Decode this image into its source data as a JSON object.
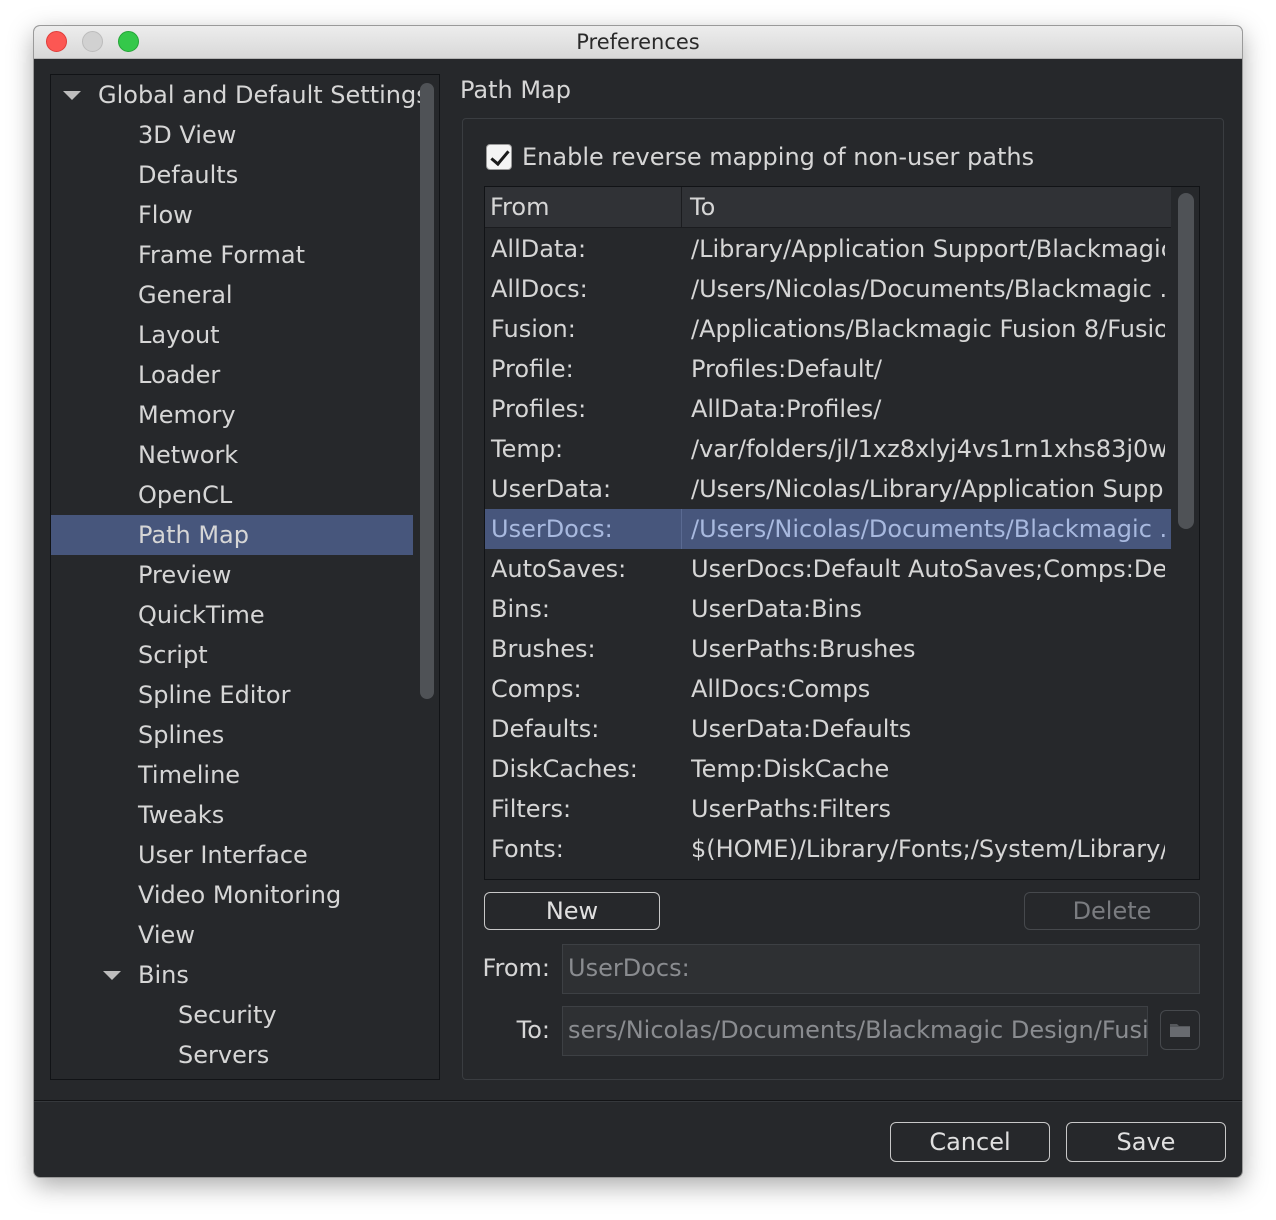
{
  "window": {
    "title": "Preferences"
  },
  "sidebar": {
    "items": [
      {
        "label": "Global and Default Settings",
        "level": 0,
        "expanded": true
      },
      {
        "label": "3D View",
        "level": 1
      },
      {
        "label": "Defaults",
        "level": 1
      },
      {
        "label": "Flow",
        "level": 1
      },
      {
        "label": "Frame Format",
        "level": 1
      },
      {
        "label": "General",
        "level": 1
      },
      {
        "label": "Layout",
        "level": 1
      },
      {
        "label": "Loader",
        "level": 1
      },
      {
        "label": "Memory",
        "level": 1
      },
      {
        "label": "Network",
        "level": 1
      },
      {
        "label": "OpenCL",
        "level": 1
      },
      {
        "label": "Path Map",
        "level": 1,
        "selected": true
      },
      {
        "label": "Preview",
        "level": 1
      },
      {
        "label": "QuickTime",
        "level": 1
      },
      {
        "label": "Script",
        "level": 1
      },
      {
        "label": "Spline Editor",
        "level": 1
      },
      {
        "label": "Splines",
        "level": 1
      },
      {
        "label": "Timeline",
        "level": 1
      },
      {
        "label": "Tweaks",
        "level": 1
      },
      {
        "label": "User Interface",
        "level": 1
      },
      {
        "label": "Video Monitoring",
        "level": 1
      },
      {
        "label": "View",
        "level": 1
      },
      {
        "label": "Bins",
        "level": 1,
        "expanded": true
      },
      {
        "label": "Security",
        "level": 2
      },
      {
        "label": "Servers",
        "level": 2
      }
    ]
  },
  "panel": {
    "title": "Path Map",
    "reverse_mapping": {
      "label": "Enable reverse mapping of non-user paths",
      "checked": true
    },
    "table": {
      "columns": [
        "From",
        "To"
      ],
      "rows": [
        {
          "from": "AllData:",
          "to": "/Library/Application Support/Blackmagic..."
        },
        {
          "from": "AllDocs:",
          "to": "/Users/Nicolas/Documents/Blackmagic ..."
        },
        {
          "from": "Fusion:",
          "to": "/Applications/Blackmagic Fusion 8/Fusio..."
        },
        {
          "from": "Profile:",
          "to": "Profiles:Default/"
        },
        {
          "from": "Profiles:",
          "to": "AllData:Profiles/"
        },
        {
          "from": "Temp:",
          "to": "/var/folders/jl/1xz8xlyj4vs1rn1xhs83j0w..."
        },
        {
          "from": "UserData:",
          "to": "/Users/Nicolas/Library/Application Supp..."
        },
        {
          "from": "UserDocs:",
          "to": "/Users/Nicolas/Documents/Blackmagic ...",
          "selected": true
        },
        {
          "from": "AutoSaves:",
          "to": "UserDocs:Default AutoSaves;Comps:Def..."
        },
        {
          "from": "Bins:",
          "to": "UserData:Bins"
        },
        {
          "from": "Brushes:",
          "to": "UserPaths:Brushes"
        },
        {
          "from": "Comps:",
          "to": "AllDocs:Comps"
        },
        {
          "from": "Defaults:",
          "to": "UserData:Defaults"
        },
        {
          "from": "DiskCaches:",
          "to": "Temp:DiskCache"
        },
        {
          "from": "Filters:",
          "to": "UserPaths:Filters"
        },
        {
          "from": "Fonts:",
          "to": "$(HOME)/Library/Fonts;/System/Library/..."
        }
      ]
    },
    "buttons": {
      "new": "New",
      "delete": "Delete"
    },
    "from_field": {
      "label": "From:",
      "value": "UserDocs:"
    },
    "to_field": {
      "label": "To:",
      "value": "sers/Nicolas/Documents/Blackmagic Design/Fusion"
    }
  },
  "footer": {
    "cancel": "Cancel",
    "save": "Save"
  },
  "colors": {
    "window_bg": "#26282b",
    "selection": "#47567c",
    "text": "#d6d6d6"
  },
  "icons": {
    "folder": "folder-icon",
    "disclosure": "triangle-down-icon",
    "check": "checkmark-icon"
  }
}
